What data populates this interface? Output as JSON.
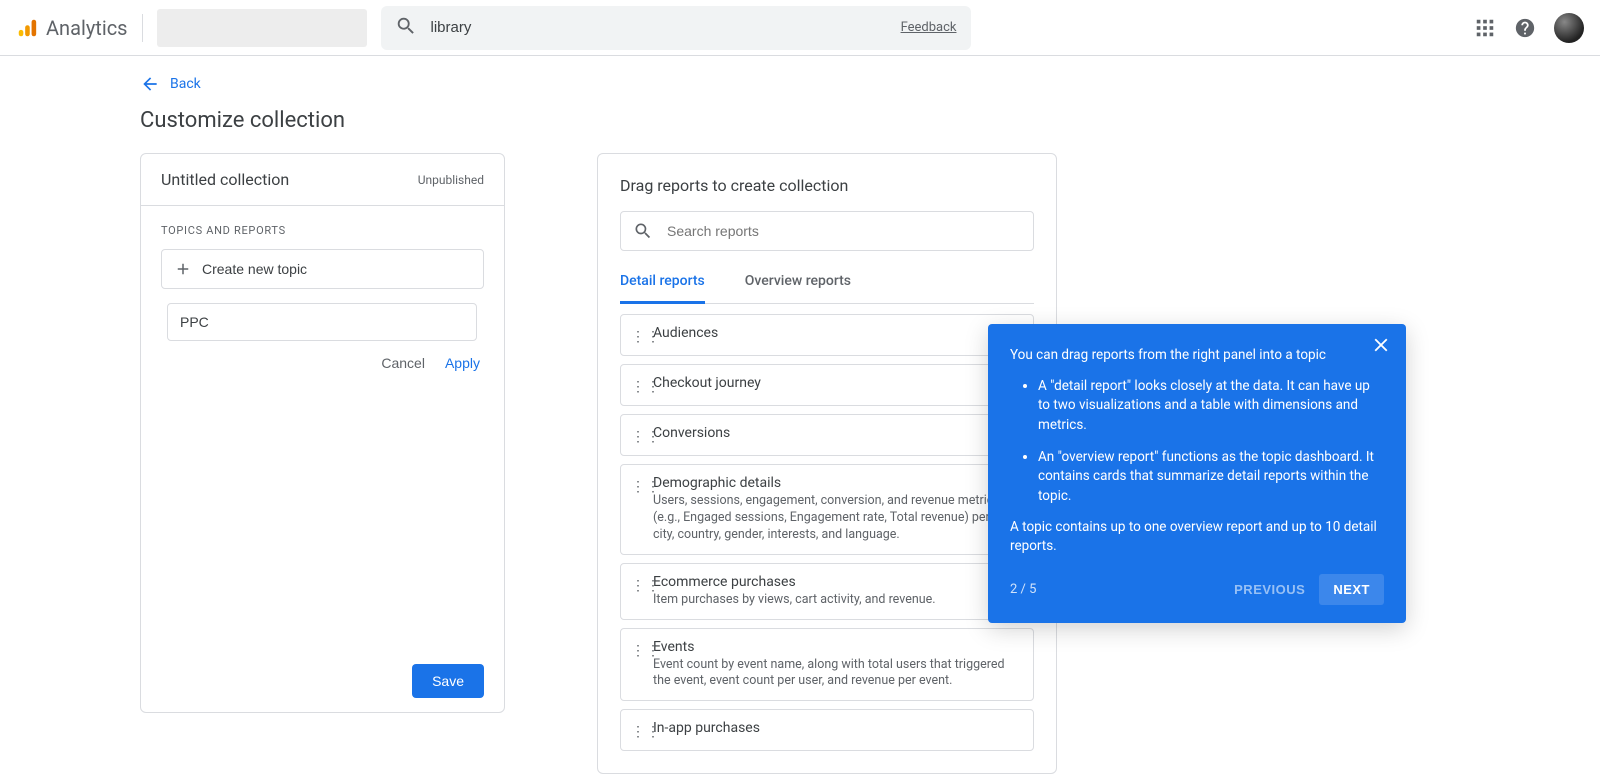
{
  "header": {
    "product": "Analytics",
    "search_value": "library",
    "feedback": "Feedback"
  },
  "back_label": "Back",
  "page_title": "Customize collection",
  "left": {
    "collection_name": "Untitled collection",
    "status": "Unpublished",
    "section_label": "TOPICS AND REPORTS",
    "create_topic_label": "Create new topic",
    "topic_input_value": "PPC",
    "cancel": "Cancel",
    "apply": "Apply",
    "save": "Save"
  },
  "right": {
    "title": "Drag reports to create collection",
    "search_placeholder": "Search reports",
    "tabs": {
      "detail": "Detail reports",
      "overview": "Overview reports"
    },
    "reports": [
      {
        "title": "Audiences",
        "desc": ""
      },
      {
        "title": "Checkout journey",
        "desc": ""
      },
      {
        "title": "Conversions",
        "desc": ""
      },
      {
        "title": "Demographic details",
        "desc": "Users, sessions, engagement, conversion, and revenue metrics (e.g., Engaged sessions, Engagement rate, Total revenue) per age, city, country, gender, interests, and language."
      },
      {
        "title": "Ecommerce purchases",
        "desc": "Item purchases by views, cart activity, and revenue."
      },
      {
        "title": "Events",
        "desc": "Event count by event name, along with total users that triggered the event, event count per user, and revenue per event."
      },
      {
        "title": "In-app purchases",
        "desc": ""
      }
    ]
  },
  "tooltip": {
    "intro": "You can drag reports from the right panel into a topic",
    "bullet1": "A \"detail report\" looks closely at the data. It can have up to two visualizations and a table with dimensions and metrics.",
    "bullet2": "An \"overview report\" functions as the topic dashboard. It contains cards that summarize detail reports within the topic.",
    "outro": "A topic contains up to one overview report and up to 10 detail reports.",
    "counter": "2 / 5",
    "previous": "PREVIOUS",
    "next": "NEXT"
  }
}
